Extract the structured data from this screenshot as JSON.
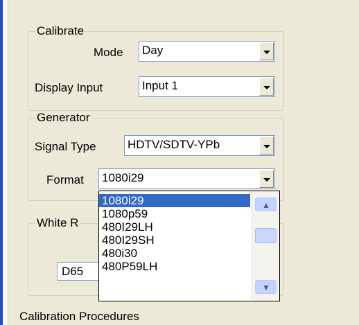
{
  "calibrate": {
    "title": "Calibrate",
    "mode_label": "Mode",
    "mode_value": "Day",
    "display_input_label": "Display Input",
    "display_input_value": "Input 1"
  },
  "generator": {
    "title": "Generator",
    "signal_type_label": "Signal Type",
    "signal_type_value": "HDTV/SDTV-YPb",
    "format_label": "Format",
    "format_value": "1080i29"
  },
  "white_ref": {
    "title_partial": "White R",
    "value_partial": "D65"
  },
  "format_dropdown": {
    "items": [
      "1080i29",
      "1080p59",
      "480I29LH",
      "480I29SH",
      "480i30",
      "480P59LH"
    ],
    "selected_index": 0
  },
  "footer": {
    "calibration_procedures": "Calibration Procedures"
  },
  "colors": {
    "accent": "#316ac5",
    "window_bg": "#ece9d8",
    "left_bar": "#1f4bd6"
  }
}
